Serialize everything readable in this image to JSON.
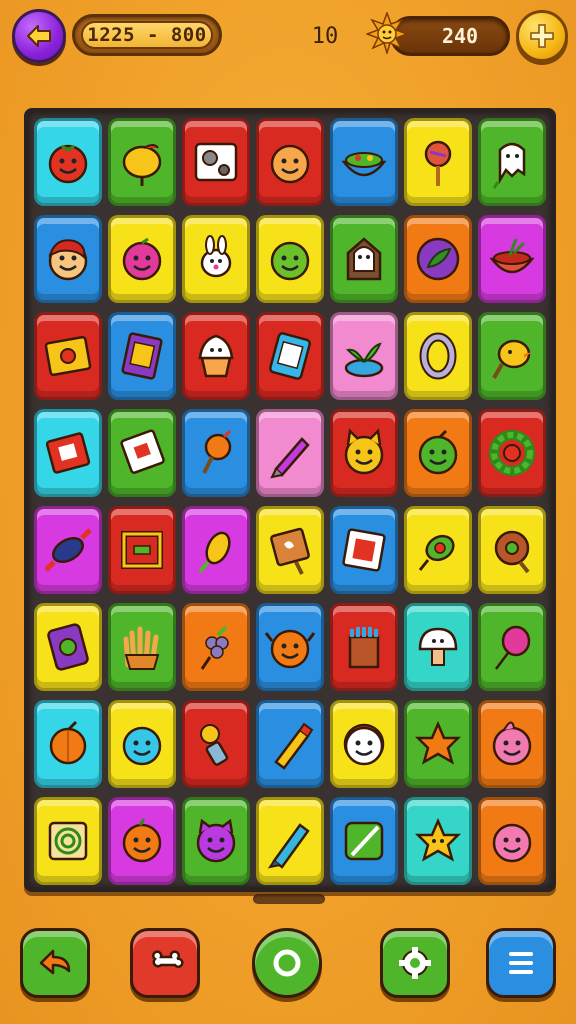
{
  "header": {
    "score_range": "1225 - 800",
    "moves": "10",
    "coins": "240"
  },
  "colors": {
    "cyan": "#35d6e8",
    "green": "#4fb52a",
    "red": "#d92a22",
    "blue": "#2a8fe0",
    "yellow": "#f7e21a",
    "orange": "#f27a14",
    "magenta": "#d73ae0",
    "pink": "#f28ad0",
    "teal": "#35d6c8"
  },
  "grid": [
    [
      {
        "color": "cyan",
        "icon": "tomato-face-icon"
      },
      {
        "color": "green",
        "icon": "lemon-icon"
      },
      {
        "color": "red",
        "icon": "gears-card-icon"
      },
      {
        "color": "red",
        "icon": "smiley-orange-icon"
      },
      {
        "color": "blue",
        "icon": "salad-bowl-icon"
      },
      {
        "color": "yellow",
        "icon": "lollipop-icon"
      },
      {
        "color": "green",
        "icon": "ghost-flag-icon"
      }
    ],
    [
      {
        "color": "blue",
        "icon": "boy-face-icon"
      },
      {
        "color": "yellow",
        "icon": "berry-face-icon"
      },
      {
        "color": "yellow",
        "icon": "bunny-icon"
      },
      {
        "color": "yellow",
        "icon": "lime-face-icon"
      },
      {
        "color": "green",
        "icon": "ghost-house-icon"
      },
      {
        "color": "orange",
        "icon": "purple-leaf-coin-icon"
      },
      {
        "color": "magenta",
        "icon": "strawberry-bowl-icon"
      }
    ],
    [
      {
        "color": "red",
        "icon": "box-icon"
      },
      {
        "color": "blue",
        "icon": "book-icon"
      },
      {
        "color": "red",
        "icon": "cupcake-icon"
      },
      {
        "color": "red",
        "icon": "tablet-icon"
      },
      {
        "color": "pink",
        "icon": "sprout-pot-icon"
      },
      {
        "color": "yellow",
        "icon": "ring-icon"
      },
      {
        "color": "green",
        "icon": "chick-icon"
      }
    ],
    [
      {
        "color": "cyan",
        "icon": "red-card-icon"
      },
      {
        "color": "green",
        "icon": "card-icon"
      },
      {
        "color": "blue",
        "icon": "carrot-icon"
      },
      {
        "color": "pink",
        "icon": "pen-icon"
      },
      {
        "color": "red",
        "icon": "cat-face-icon"
      },
      {
        "color": "orange",
        "icon": "apple-face-icon"
      },
      {
        "color": "red",
        "icon": "wreath-icon"
      }
    ],
    [
      {
        "color": "magenta",
        "icon": "candy-wrapper-icon"
      },
      {
        "color": "red",
        "icon": "frame-icon"
      },
      {
        "color": "magenta",
        "icon": "corn-icon"
      },
      {
        "color": "yellow",
        "icon": "scroll-icon"
      },
      {
        "color": "blue",
        "icon": "photo-card-icon"
      },
      {
        "color": "yellow",
        "icon": "olive-icon"
      },
      {
        "color": "yellow",
        "icon": "donut-icon"
      }
    ],
    [
      {
        "color": "yellow",
        "icon": "phone-icon"
      },
      {
        "color": "green",
        "icon": "fries-icon"
      },
      {
        "color": "orange",
        "icon": "grapes-icon"
      },
      {
        "color": "blue",
        "icon": "crab-icon"
      },
      {
        "color": "red",
        "icon": "crayons-icon"
      },
      {
        "color": "teal",
        "icon": "mushroom-face-icon"
      },
      {
        "color": "green",
        "icon": "balloon-icon"
      }
    ],
    [
      {
        "color": "cyan",
        "icon": "orange-fruit-icon"
      },
      {
        "color": "yellow",
        "icon": "blue-face-icon"
      },
      {
        "color": "red",
        "icon": "flower-pot-icon"
      },
      {
        "color": "blue",
        "icon": "pencil-icon"
      },
      {
        "color": "yellow",
        "icon": "badge-face-icon"
      },
      {
        "color": "green",
        "icon": "orange-star-icon"
      },
      {
        "color": "orange",
        "icon": "drop-face-icon"
      }
    ],
    [
      {
        "color": "yellow",
        "icon": "spiral-card-icon"
      },
      {
        "color": "magenta",
        "icon": "pumpkin-face-icon"
      },
      {
        "color": "green",
        "icon": "purple-cat-icon"
      },
      {
        "color": "yellow",
        "icon": "marker-icon"
      },
      {
        "color": "blue",
        "icon": "leaf-card-icon"
      },
      {
        "color": "teal",
        "icon": "star-face-icon"
      },
      {
        "color": "orange",
        "icon": "pink-face-icon"
      }
    ]
  ],
  "bottom_bar": [
    {
      "name": "undo-button",
      "color": "#4fb52a",
      "icon": "undo-arrow-icon"
    },
    {
      "name": "bone-button",
      "color": "#e23a2a",
      "icon": "bone-icon"
    },
    {
      "name": "refresh-button",
      "color": "#4fb52a",
      "icon": "refresh-icon"
    },
    {
      "name": "settings-button",
      "color": "#4fb52a",
      "icon": "gear-icon"
    },
    {
      "name": "menu-button",
      "color": "#2a8fe0",
      "icon": "menu-icon"
    }
  ]
}
